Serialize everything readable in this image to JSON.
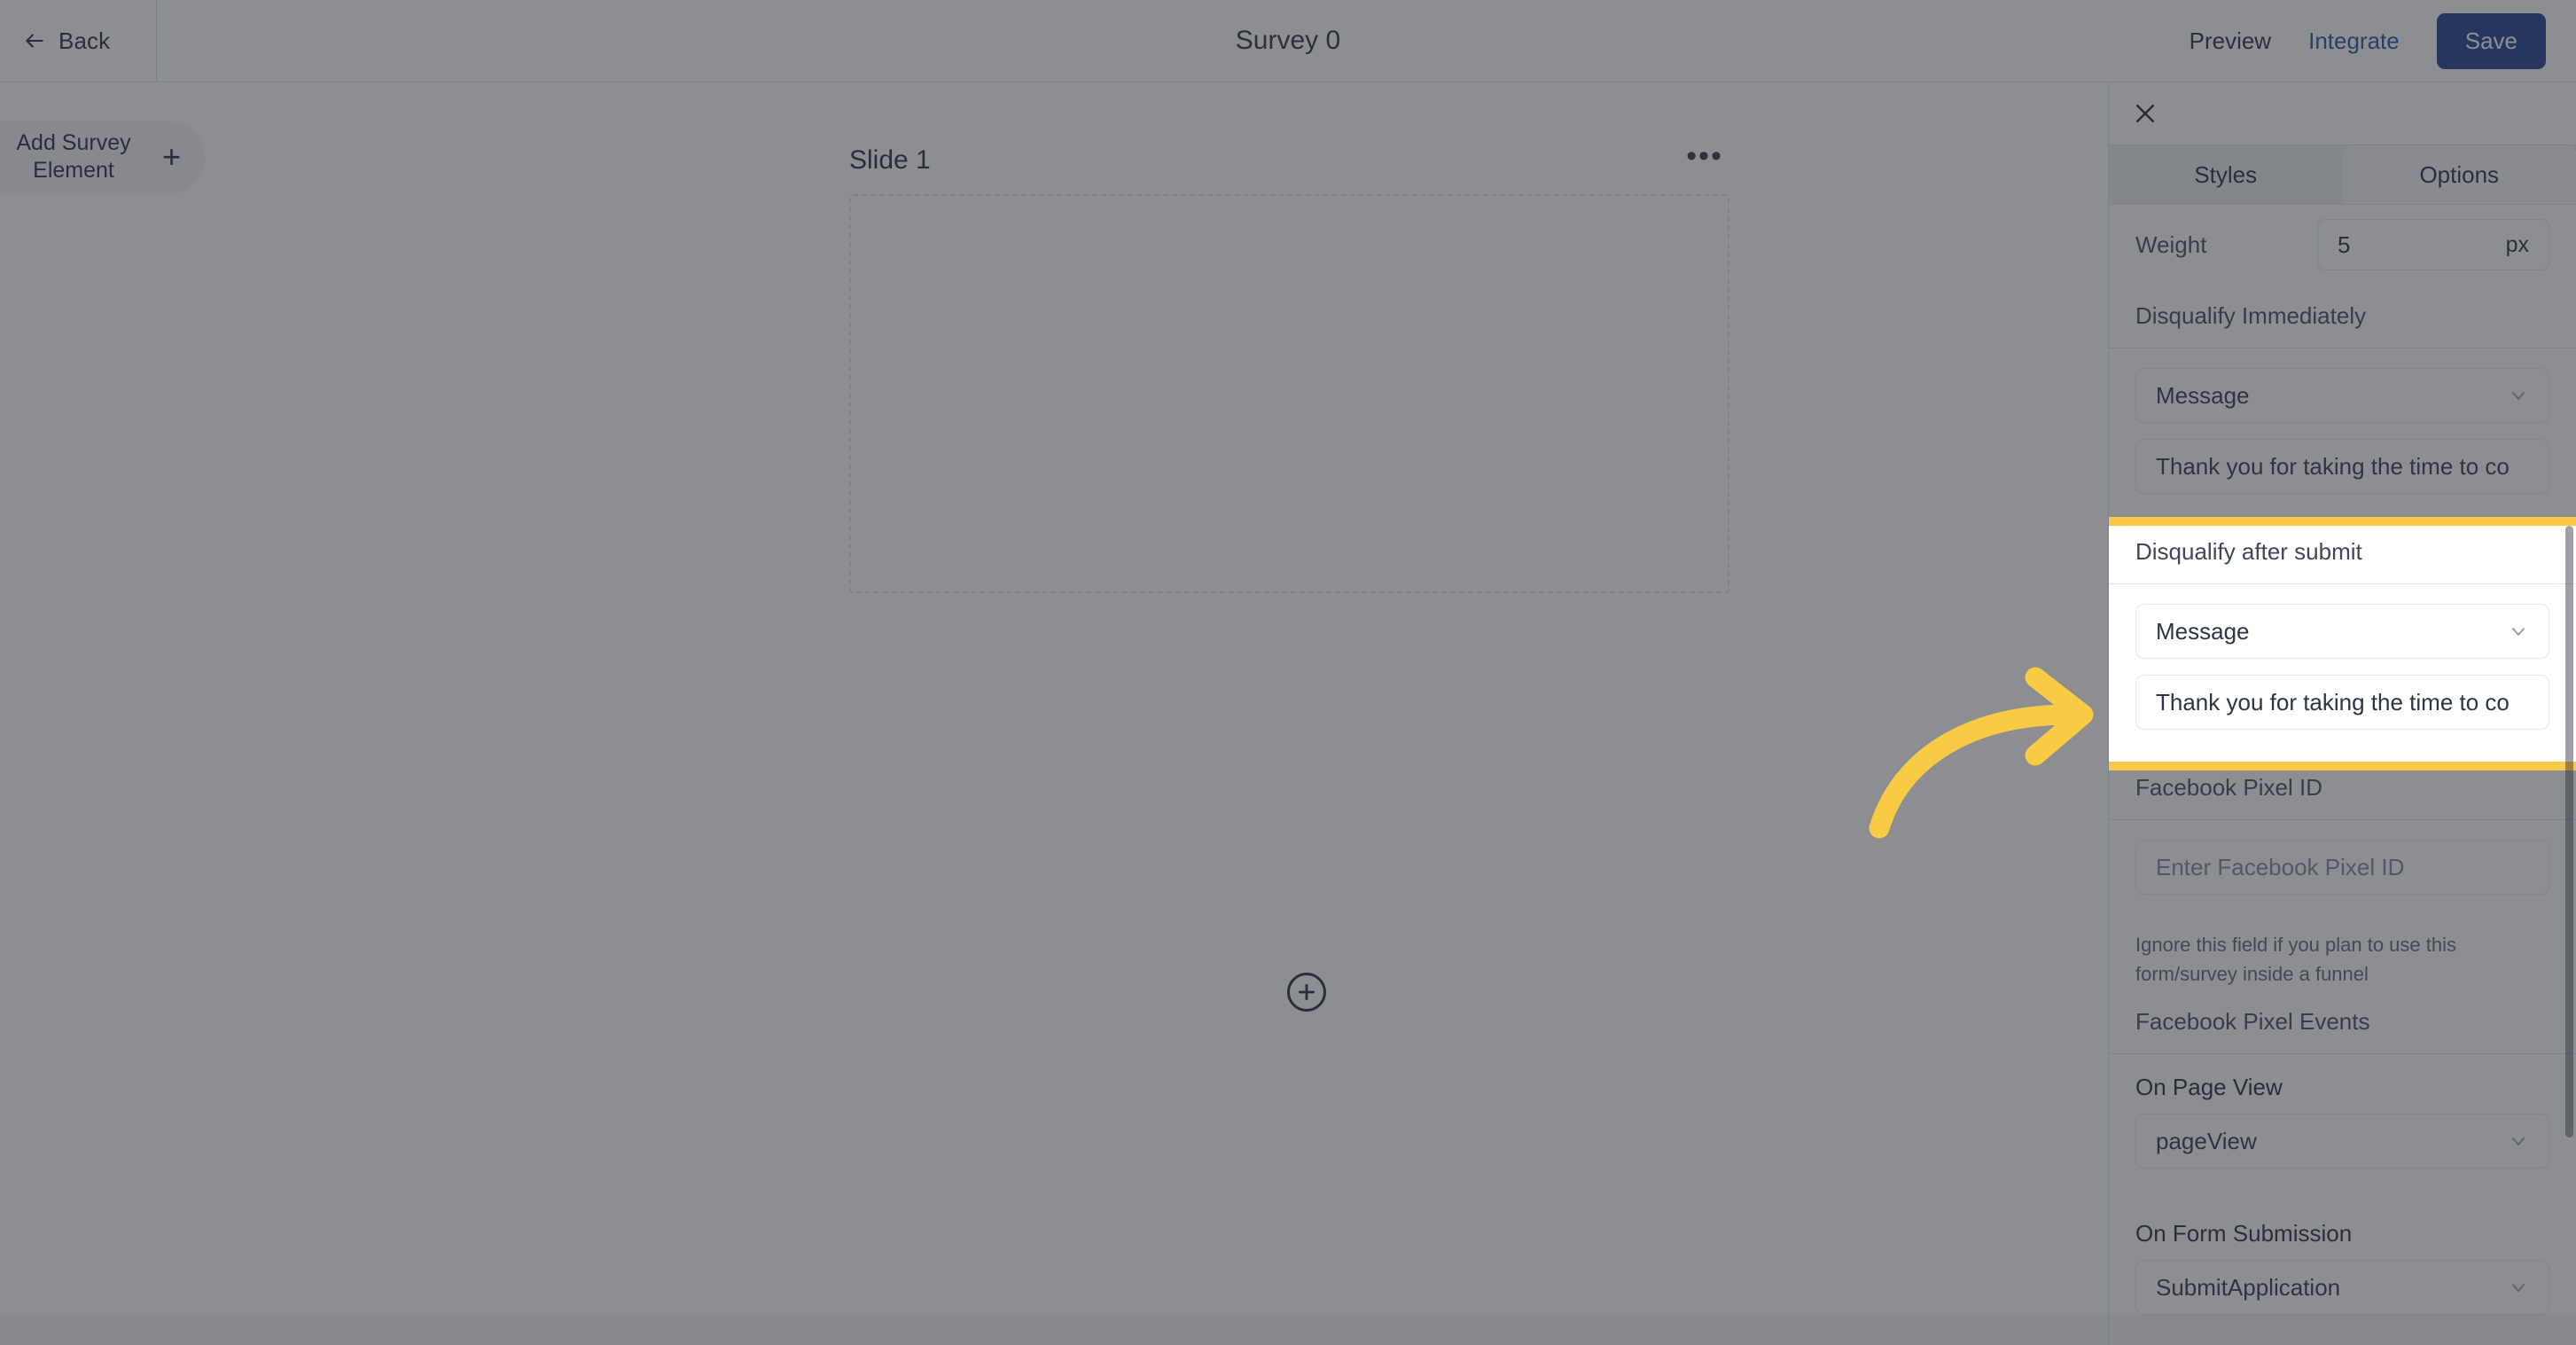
{
  "topbar": {
    "back_label": "Back",
    "title": "Survey 0",
    "preview_label": "Preview",
    "integrate_label": "Integrate",
    "save_label": "Save"
  },
  "left_rail": {
    "add_element_label": "Add Survey Element",
    "add_icon": "plus-icon"
  },
  "canvas": {
    "slide_title": "Slide 1",
    "slide_menu_glyph": "•••",
    "add_slide_icon": "plus-circle-icon"
  },
  "panel": {
    "close_icon": "close-icon",
    "tabs": [
      {
        "label": "Styles",
        "active": false
      },
      {
        "label": "Options",
        "active": true
      }
    ],
    "weight": {
      "label": "Weight",
      "value": "5",
      "unit": "px"
    },
    "disqualify_immediately": {
      "title": "Disqualify Immediately",
      "type_value": "Message",
      "message_value": "Thank you for taking the time to co"
    },
    "disqualify_after_submit": {
      "title": "Disqualify after submit",
      "type_value": "Message",
      "message_value": "Thank you for taking the time to co",
      "highlighted": true
    },
    "facebook_pixel_id": {
      "title": "Facebook Pixel ID",
      "input_placeholder": "Enter Facebook Pixel ID",
      "input_value": "",
      "helper": "Ignore this field if you plan to use this form/survey inside a funnel"
    },
    "facebook_pixel_events": {
      "title": "Facebook Pixel Events",
      "on_page_view_label": "On Page View",
      "on_page_view_value": "pageView",
      "on_form_submission_label": "On Form Submission",
      "on_form_submission_value": "SubmitApplication"
    }
  },
  "annotation": {
    "arrow_icon": "curved-arrow-right-icon",
    "highlight_color": "#FBC94A",
    "arrow_color": "#F9CA43",
    "dim_color": "rgba(50,54,60,.56)"
  },
  "colors": {
    "accent_link": "#1b4ea0",
    "save_button_bg": "#16398c",
    "highlight": "#FBC94A"
  }
}
